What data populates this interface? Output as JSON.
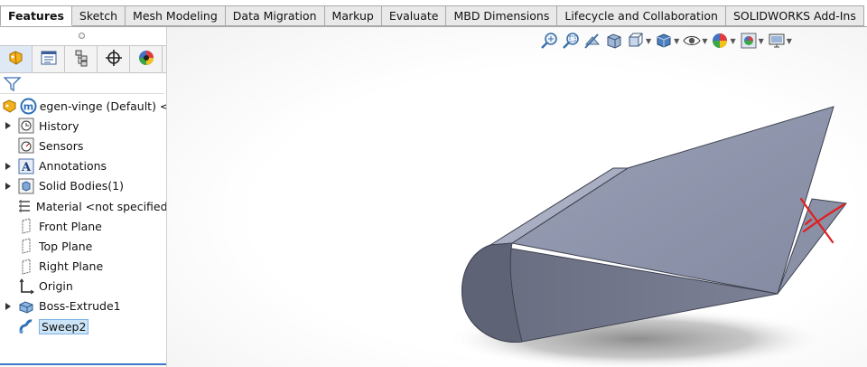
{
  "tabs": [
    {
      "label": "Features",
      "active": true
    },
    {
      "label": "Sketch",
      "active": false
    },
    {
      "label": "Mesh Modeling",
      "active": false
    },
    {
      "label": "Data Migration",
      "active": false
    },
    {
      "label": "Markup",
      "active": false
    },
    {
      "label": "Evaluate",
      "active": false
    },
    {
      "label": "MBD Dimensions",
      "active": false
    },
    {
      "label": "Lifecycle and Collaboration",
      "active": false
    },
    {
      "label": "SOLIDWORKS Add-Ins",
      "active": false
    }
  ],
  "panel_tabs": [
    "featuremanager-icon",
    "propertymanager-icon",
    "configurationmanager-icon",
    "dimxpert-icon",
    "display-manager-icon"
  ],
  "tree": {
    "root": "egen-vinge (Default) <<D",
    "items": [
      {
        "label": "History",
        "icon": "history-icon",
        "expandable": true
      },
      {
        "label": "Sensors",
        "icon": "sensors-icon",
        "expandable": false
      },
      {
        "label": "Annotations",
        "icon": "annotations-icon",
        "expandable": true
      },
      {
        "label": "Solid Bodies(1)",
        "icon": "solid-bodies-icon",
        "expandable": true
      },
      {
        "label": "Material <not specified>",
        "icon": "material-icon",
        "expandable": false
      },
      {
        "label": "Front Plane",
        "icon": "plane-icon",
        "expandable": false
      },
      {
        "label": "Top Plane",
        "icon": "plane-icon",
        "expandable": false
      },
      {
        "label": "Right Plane",
        "icon": "plane-icon",
        "expandable": false
      },
      {
        "label": "Origin",
        "icon": "origin-icon",
        "expandable": false
      },
      {
        "label": "Boss-Extrude1",
        "icon": "boss-extrude-icon",
        "expandable": true
      },
      {
        "label": "Sweep2",
        "icon": "sweep-icon",
        "expandable": false,
        "selected": true
      }
    ]
  },
  "heads_up_toolbar": [
    "zoom-to-fit-icon",
    "zoom-to-area-icon",
    "previous-view-icon",
    "section-view-icon",
    "view-orientation-icon",
    "display-style-icon",
    "hide-show-items-icon",
    "edit-appearance-icon",
    "apply-scene-icon",
    "view-settings-icon"
  ],
  "colors": {
    "body_face_top": "#8f95ab",
    "body_face_front": "#6e7387",
    "body_face_end": "#5f6376",
    "selection_blue": "#3c78c3",
    "annotation_red": "#e02020"
  }
}
